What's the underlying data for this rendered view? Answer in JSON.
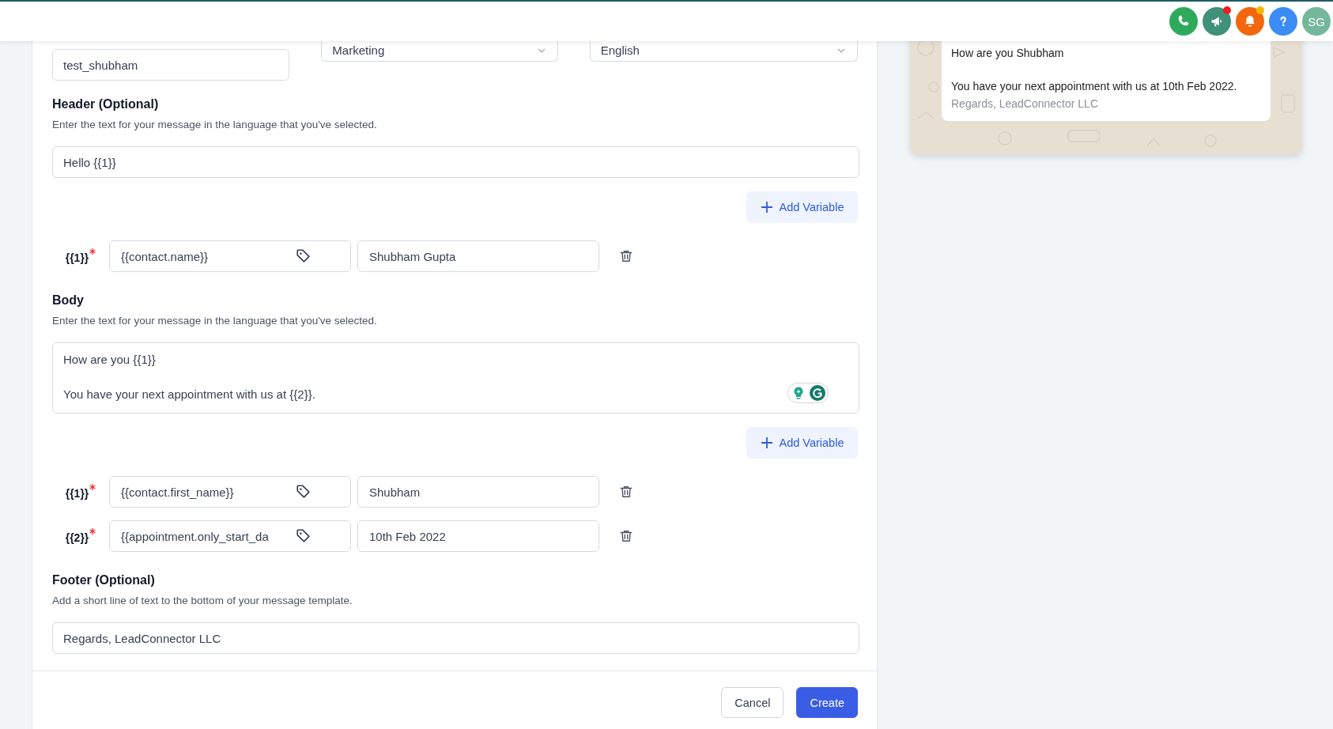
{
  "topbar": {
    "icons": [
      {
        "kind": "phone"
      },
      {
        "kind": "megaphone",
        "color": "#ef1c24"
      },
      {
        "kind": "bell",
        "color": "#f5b800"
      },
      {
        "kind": "help"
      }
    ],
    "avatar": "SG"
  },
  "form": {
    "name": "test_shubham",
    "category": "Marketing",
    "language": "English",
    "sections": [
      {
        "kind": "header",
        "title": "Header (Optional)",
        "description": "Enter the text for your message in the language that you've selected.",
        "text": "Hello {{1}}",
        "add_button": "Add Variable",
        "variables": [
          {
            "label": "{{1}}",
            "required": true,
            "field": "{{contact.name}}",
            "sample": "Shubham Gupta"
          }
        ]
      },
      {
        "kind": "body",
        "title": "Body",
        "description": "Enter the text for your message in the language that you've selected.",
        "text": "How are you {{1}}\n\nYou have your next appointment with us at {{2}}.",
        "add_button": "Add Variable",
        "variables": [
          {
            "label": "{{1}}",
            "required": true,
            "field": "{{contact.first_name}}",
            "sample": "Shubham"
          },
          {
            "label": "{{2}}",
            "required": true,
            "field": "{{appointment.only_start_da",
            "sample": "10th Feb 2022"
          }
        ]
      },
      {
        "kind": "footer",
        "title": "Footer (Optional)",
        "description": "Add a short line of text to the bottom of your message template.",
        "text": "Regards, LeadConnector LLC"
      }
    ],
    "cancel": "Cancel",
    "create": "Create"
  },
  "preview": {
    "message": "How are you Shubham\n\nYou have your next appointment with us at 10th Feb 2022.",
    "footer": "Regards, LeadConnector LLC"
  }
}
